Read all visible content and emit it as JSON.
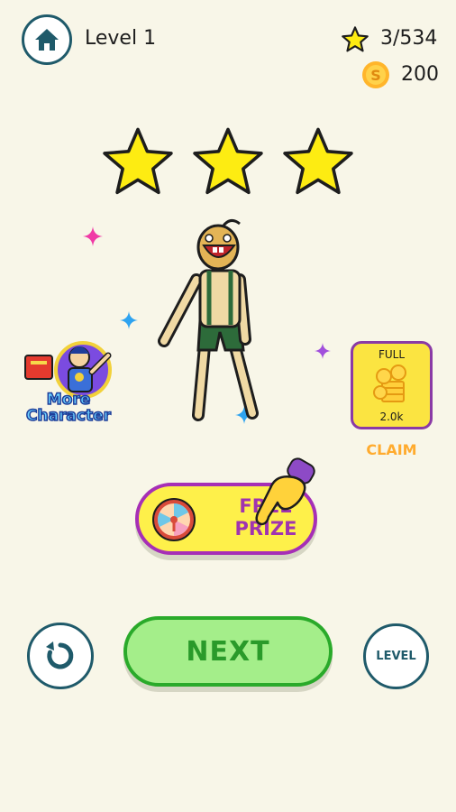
{
  "header": {
    "level_label": "Level 1",
    "stars_count": "3/534",
    "coins": "200"
  },
  "result": {
    "stars_earned": 3,
    "stars_total": 3
  },
  "chest": {
    "status": "FULL",
    "amount": "2.0k",
    "claim_label": "CLAIM"
  },
  "prize": {
    "label_line1": "FREE",
    "label_line2": "PRIZE"
  },
  "more_character": {
    "line1": "More",
    "line2": "Character"
  },
  "buttons": {
    "next_label": "NEXT",
    "level_label": "LEVEL"
  },
  "colors": {
    "background": "#f8f6e8",
    "star_yellow": "#fdec12",
    "next_green": "#a4ee8a",
    "prize_yellow": "#fef04a",
    "purple": "#a62fb6",
    "claim_orange": "#ffab2e",
    "icon_teal": "#1f5a6a"
  },
  "icons": [
    "home-icon",
    "star-icon",
    "coin-icon",
    "restart-icon",
    "wheel-icon",
    "pointing-hand-icon",
    "chest-coins-icon",
    "sparkle-icon"
  ]
}
